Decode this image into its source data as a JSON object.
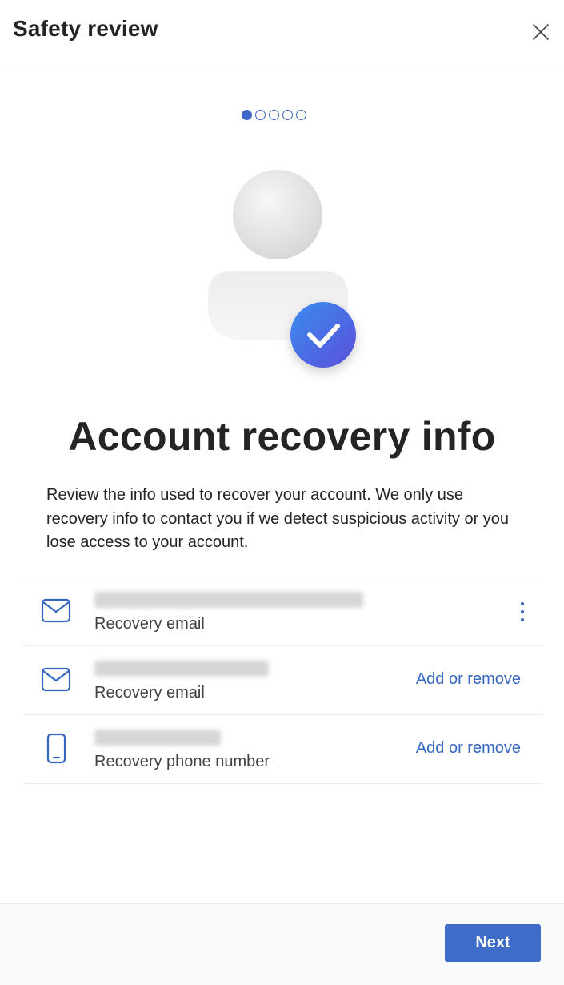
{
  "header": {
    "title": "Safety review",
    "close_icon": "close-icon"
  },
  "progress": {
    "current_step": 1,
    "total_steps": 5,
    "active_color": "#3e64c6"
  },
  "illustration": {
    "name": "person-with-checkmark",
    "badge_icon": "checkmark-icon"
  },
  "main": {
    "heading": "Account recovery info",
    "description": "Review the info used to recover your account. We only use recovery info to contact you if we detect suspicious activity or you lose access to your account."
  },
  "recovery_items": [
    {
      "icon": "mail-icon",
      "value_state": "blurred",
      "label": "Recovery email",
      "action": "more-options"
    },
    {
      "icon": "mail-icon",
      "value_state": "blurred",
      "label": "Recovery email",
      "action_label": "Add or remove"
    },
    {
      "icon": "phone-icon",
      "value_state": "blurred",
      "label": "Recovery phone number",
      "action_label": "Add or remove"
    }
  ],
  "footer": {
    "next_label": "Next"
  },
  "colors": {
    "accent": "#3e6cc9",
    "link": "#3366c0",
    "text": "#242424"
  }
}
